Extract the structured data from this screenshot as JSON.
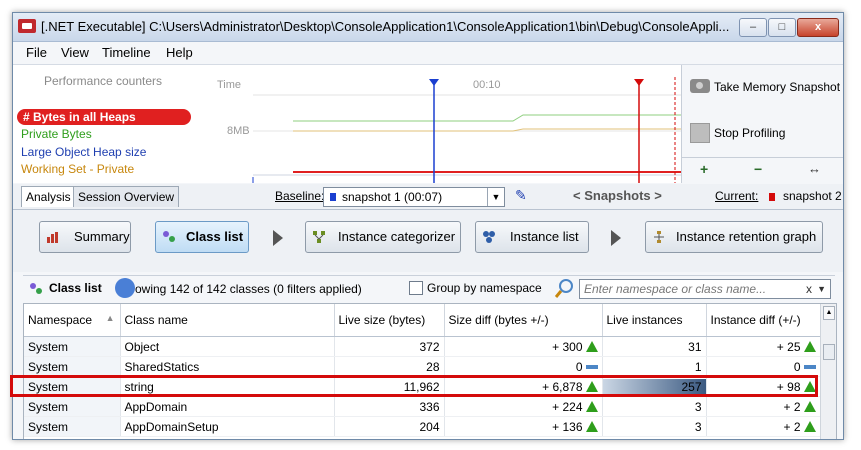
{
  "window": {
    "title": "[.NET Executable] C:\\Users\\Administrator\\Desktop\\ConsoleApplication1\\ConsoleApplication1\\bin\\Debug\\ConsoleAppli...",
    "min_glyph": "–",
    "max_glyph": "□",
    "close_glyph": "x"
  },
  "menu": {
    "file": "File",
    "view": "View",
    "timeline": "Timeline",
    "help": "Help"
  },
  "perf_counters": {
    "title": "Performance counters",
    "items": [
      {
        "label": "# Bytes in all Heaps",
        "color": "#ffffff"
      },
      {
        "label": "Private Bytes",
        "color": "#2f9e1c"
      },
      {
        "label": "Large Object Heap size",
        "color": "#1f3fb0"
      },
      {
        "label": "Working Set - Private",
        "color": "#c7870d"
      }
    ]
  },
  "timeline": {
    "time_label": "Time",
    "tick_label": "00:10",
    "y_label": "8MB"
  },
  "actions": {
    "snapshot": "Take Memory Snapshot",
    "stop": "Stop Profiling",
    "zoom_in_glyph": "+",
    "zoom_out_glyph": "−",
    "fit_glyph": "↔"
  },
  "tabs_row": {
    "analysis": "Analysis",
    "session": "Session Overview",
    "baseline_label": "Baseline:",
    "baseline_value": "snapshot 1 (00:07)",
    "snapshots_nav": "< Snapshots >",
    "current_label": "Current:",
    "current_value": "snapshot 2"
  },
  "nav": {
    "summary": "Summary",
    "class_list": "Class list",
    "categorizer": "Instance categorizer",
    "instance_list": "Instance list",
    "retention": "Instance retention graph"
  },
  "class_list_bar": {
    "title": "Class list",
    "showing": "owing 142 of 142 classes (0 filters applied)",
    "group_label": "Group by namespace",
    "filter_placeholder": "Enter namespace or class name...",
    "clear_glyph": "x"
  },
  "grid": {
    "columns": [
      "Namespace",
      "Class name",
      "Live size (bytes)",
      "Size diff (bytes +/-)",
      "Live instances",
      "Instance diff (+/-)"
    ],
    "rows": [
      {
        "ns": "System",
        "cls": "Object",
        "live": "372",
        "diff": "+ 300",
        "diff_dir": "up",
        "inst": "31",
        "inst_level": 0,
        "idiff": "+ 25",
        "idiff_dir": "up"
      },
      {
        "ns": "System",
        "cls": "SharedStatics",
        "live": "28",
        "diff": "0",
        "diff_dir": "zero",
        "inst": "1",
        "inst_level": 0,
        "idiff": "0",
        "idiff_dir": "zero"
      },
      {
        "ns": "System",
        "cls": "string",
        "live": "11,962",
        "diff": "+ 6,878",
        "diff_dir": "up",
        "inst": "257",
        "inst_level": 1.0,
        "idiff": "+ 98",
        "idiff_dir": "up"
      },
      {
        "ns": "System",
        "cls": "AppDomain",
        "live": "336",
        "diff": "+ 224",
        "diff_dir": "up",
        "inst": "3",
        "inst_level": 0,
        "idiff": "+ 2",
        "idiff_dir": "up"
      },
      {
        "ns": "System",
        "cls": "AppDomainSetup",
        "live": "204",
        "diff": "+ 136",
        "diff_dir": "up",
        "inst": "3",
        "inst_level": 0,
        "idiff": "+ 2",
        "idiff_dir": "up"
      }
    ]
  }
}
